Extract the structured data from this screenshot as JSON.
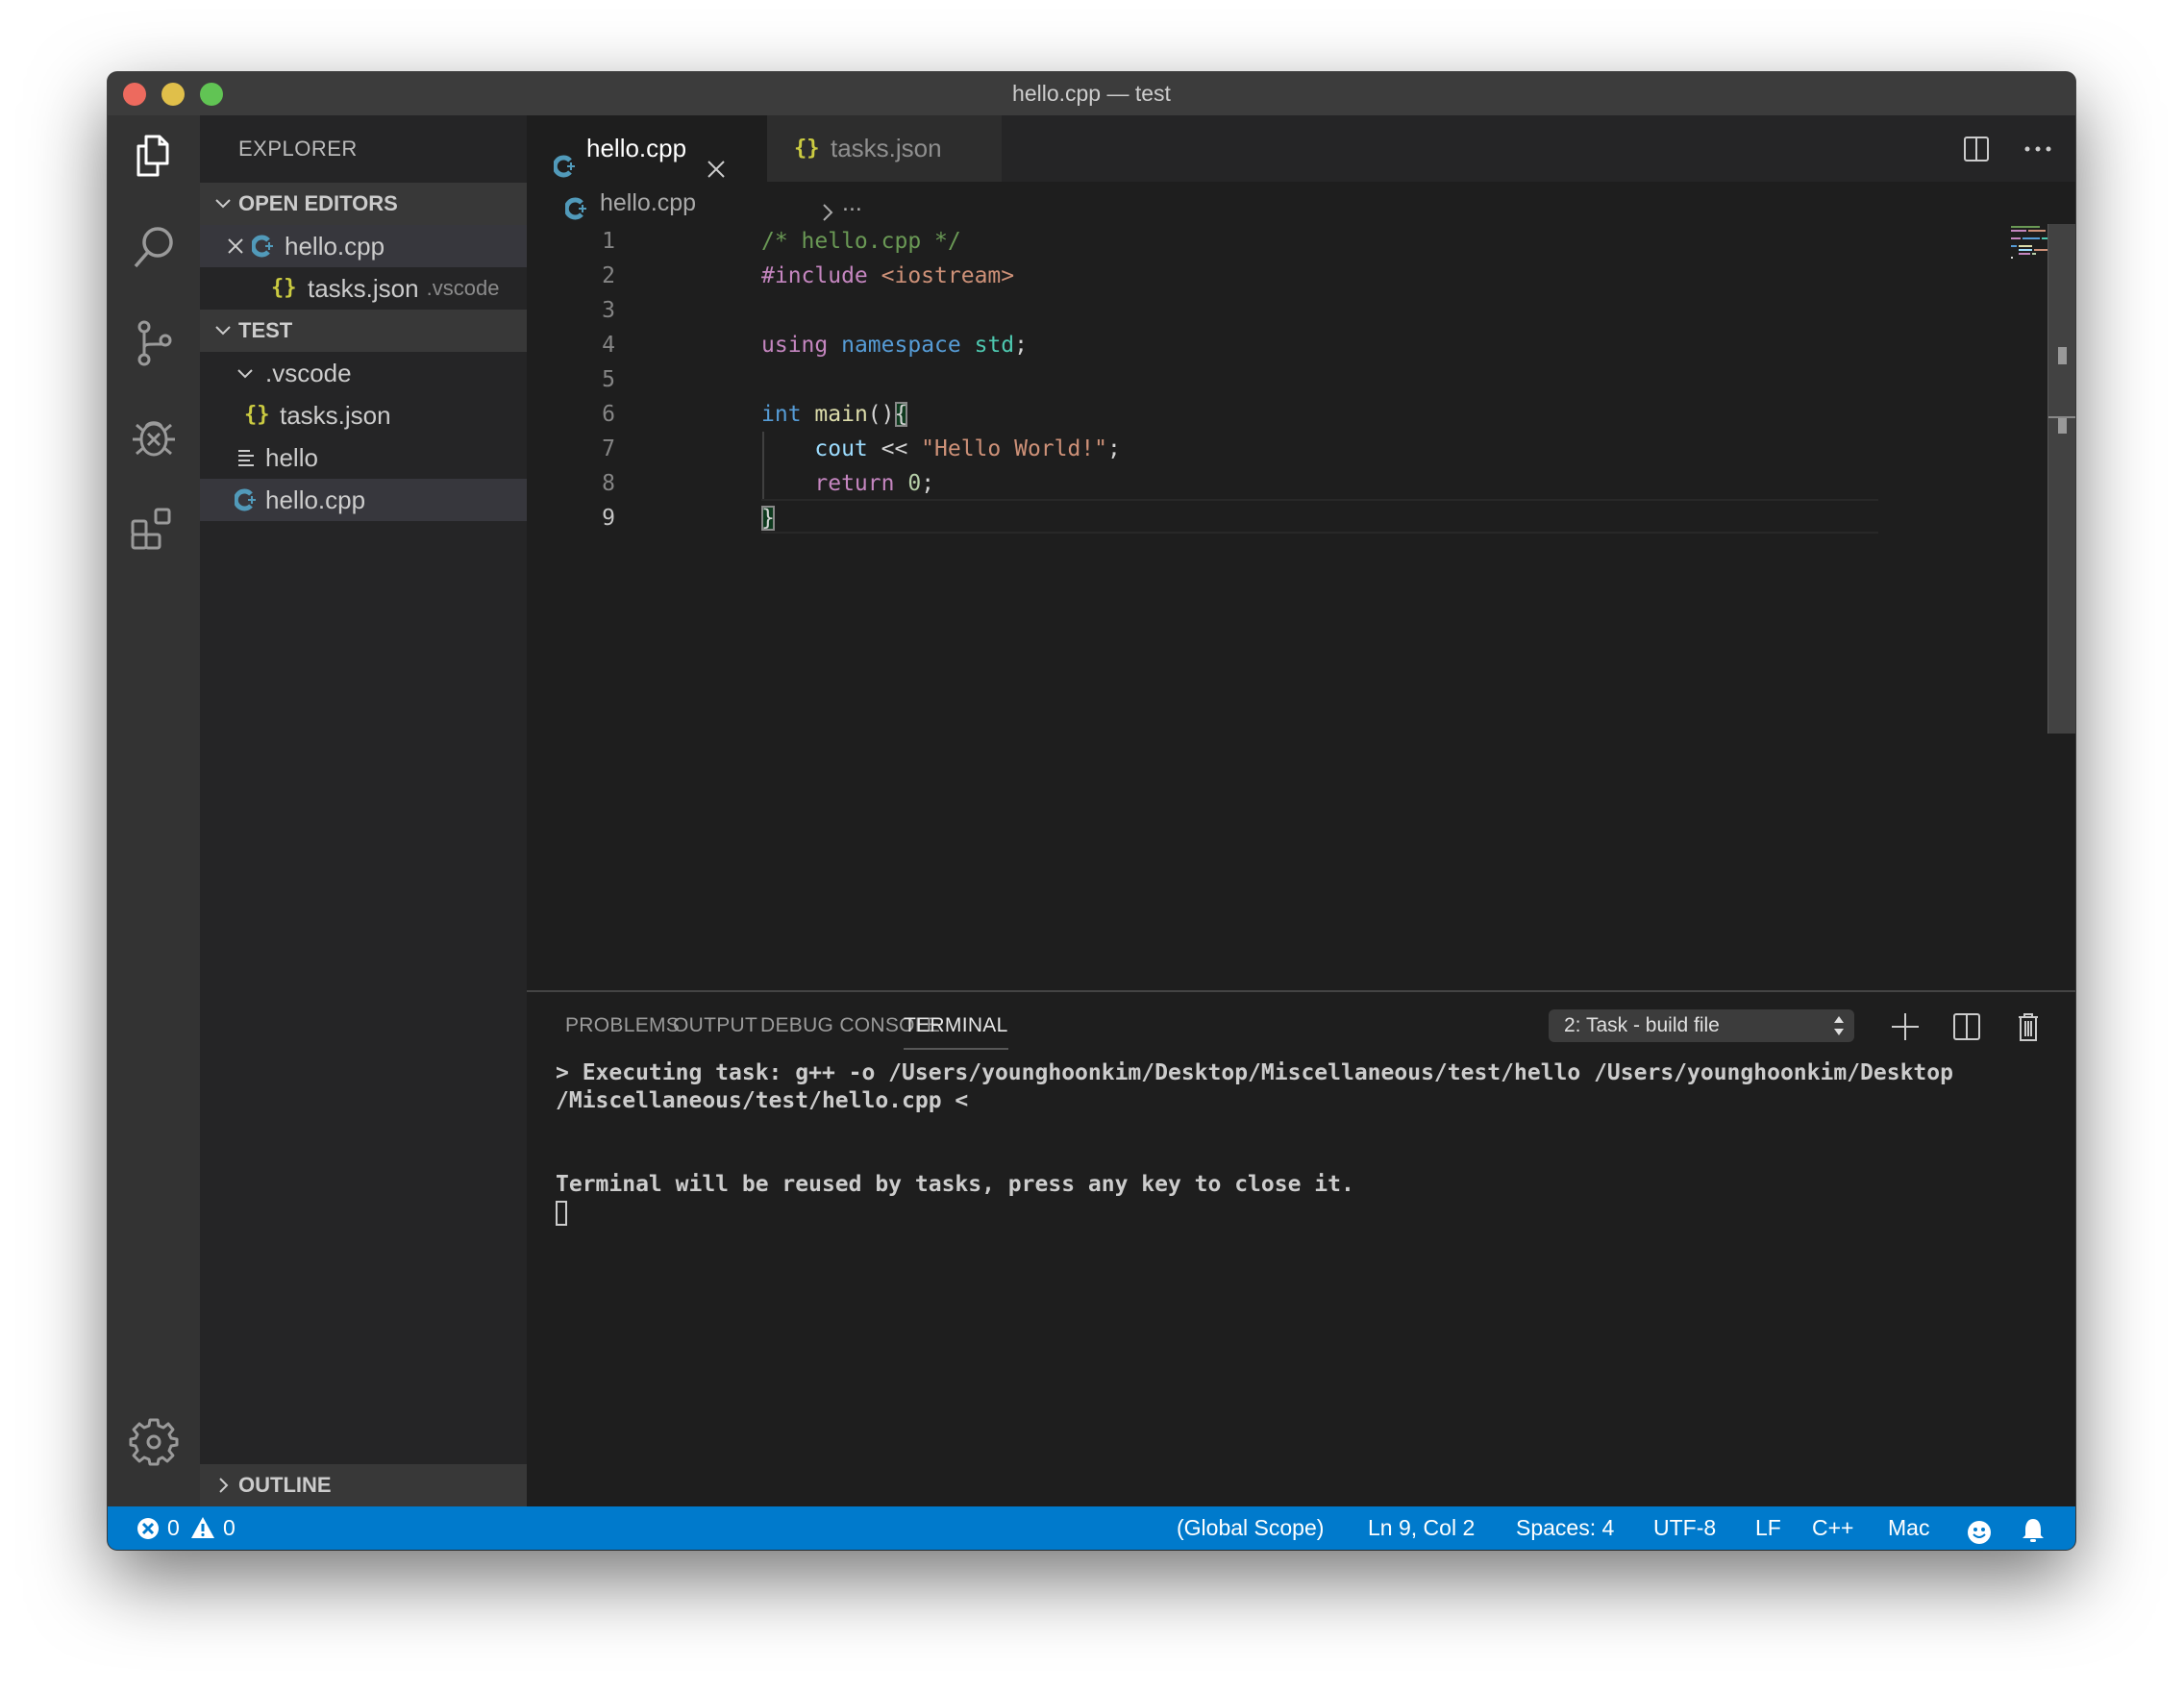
{
  "window": {
    "title": "hello.cpp — test"
  },
  "activity_bar": {
    "items": [
      {
        "name": "explorer",
        "icon": "files-icon",
        "active": true
      },
      {
        "name": "search",
        "icon": "search-icon",
        "active": false
      },
      {
        "name": "source-control",
        "icon": "source-control-icon",
        "active": false
      },
      {
        "name": "debug",
        "icon": "debug-icon",
        "active": false
      },
      {
        "name": "extensions",
        "icon": "extensions-icon",
        "active": false
      }
    ],
    "bottom": {
      "name": "manage",
      "icon": "gear-icon"
    }
  },
  "sidebar": {
    "title": "EXPLORER",
    "open_editors": {
      "label": "OPEN EDITORS",
      "items": [
        {
          "name": "hello.cpp",
          "icon": "cpp-icon",
          "icon_glyph": "C+",
          "dirty_close": true,
          "suffix": ""
        },
        {
          "name": "tasks.json",
          "icon": "json-icon",
          "icon_glyph": "{}",
          "suffix": ".vscode"
        }
      ]
    },
    "folder": {
      "label": "TEST",
      "items": [
        {
          "name": ".vscode",
          "type": "folder",
          "expanded": true
        },
        {
          "name": "tasks.json",
          "type": "json",
          "icon_glyph": "{}"
        },
        {
          "name": "hello",
          "type": "binary",
          "icon_glyph": "≡"
        },
        {
          "name": "hello.cpp",
          "type": "cpp",
          "icon_glyph": "C+",
          "selected": true
        }
      ]
    },
    "outline": {
      "label": "OUTLINE"
    }
  },
  "editor": {
    "tabs": [
      {
        "label": "hello.cpp",
        "icon_glyph": "C+",
        "active": true
      },
      {
        "label": "tasks.json",
        "icon_glyph": "{}",
        "active": false
      }
    ],
    "breadcrumb": {
      "file": "hello.cpp",
      "rest": "..."
    },
    "lines": [
      {
        "n": "1",
        "tokens": [
          {
            "t": "comment",
            "v": "/* hello.cpp */"
          }
        ]
      },
      {
        "n": "2",
        "tokens": [
          {
            "t": "pre",
            "v": "#include"
          },
          {
            "t": "pl",
            "v": " "
          },
          {
            "t": "inc",
            "v": "<iostream>"
          }
        ]
      },
      {
        "n": "3",
        "tokens": []
      },
      {
        "n": "4",
        "tokens": [
          {
            "t": "kw",
            "v": "using"
          },
          {
            "t": "pl",
            "v": " "
          },
          {
            "t": "kw2",
            "v": "namespace"
          },
          {
            "t": "pl",
            "v": " "
          },
          {
            "t": "ns",
            "v": "std"
          },
          {
            "t": "pl",
            "v": ";"
          }
        ]
      },
      {
        "n": "5",
        "tokens": []
      },
      {
        "n": "6",
        "tokens": [
          {
            "t": "kw2",
            "v": "int"
          },
          {
            "t": "pl",
            "v": " "
          },
          {
            "t": "fn",
            "v": "main"
          },
          {
            "t": "pl",
            "v": "()"
          },
          {
            "t": "bracket",
            "v": "{"
          }
        ]
      },
      {
        "n": "7",
        "tokens": [
          {
            "t": "pl",
            "v": "    "
          },
          {
            "t": "var",
            "v": "cout"
          },
          {
            "t": "pl",
            "v": " << "
          },
          {
            "t": "str",
            "v": "\"Hello World!\""
          },
          {
            "t": "pl",
            "v": ";"
          }
        ]
      },
      {
        "n": "8",
        "tokens": [
          {
            "t": "pl",
            "v": "    "
          },
          {
            "t": "kw",
            "v": "return"
          },
          {
            "t": "pl",
            "v": " "
          },
          {
            "t": "num",
            "v": "0"
          },
          {
            "t": "pl",
            "v": ";"
          }
        ]
      },
      {
        "n": "9",
        "tokens": [
          {
            "t": "bracket",
            "v": "}"
          }
        ]
      }
    ],
    "current_line": 9
  },
  "panel": {
    "tabs": [
      {
        "label": "PROBLEMS",
        "active": false
      },
      {
        "label": "OUTPUT",
        "active": false
      },
      {
        "label": "DEBUG CONSOLE",
        "active": false
      },
      {
        "label": "TERMINAL",
        "active": true
      }
    ],
    "terminal_selector": "2: Task - build file",
    "actions": [
      "new-terminal",
      "split-terminal",
      "kill-terminal",
      "maximize-panel",
      "close-panel"
    ],
    "terminal_lines": [
      "> Executing task: g++ -o /Users/younghoonkim/Desktop/Miscellaneous/test/hello /Users/younghoonkim/Desktop",
      "/Miscellaneous/test/hello.cpp <",
      "",
      "",
      "Terminal will be reused by tasks, press any key to close it."
    ]
  },
  "status_bar": {
    "errors": "0",
    "warnings": "0",
    "scope": "(Global Scope)",
    "position": "Ln 9, Col 2",
    "indent": "Spaces: 4",
    "encoding": "UTF-8",
    "eol": "LF",
    "language": "C++",
    "platform": "Mac",
    "colors": {
      "background": "#007acc"
    }
  }
}
